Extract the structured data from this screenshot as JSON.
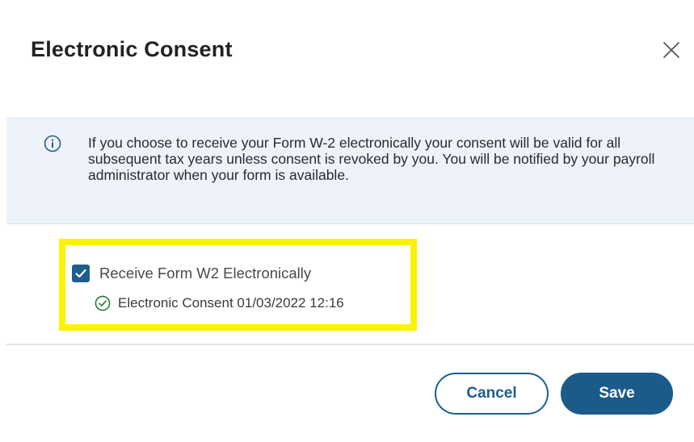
{
  "dialog": {
    "title": "Electronic Consent",
    "close_icon": "close-icon"
  },
  "info": {
    "icon": "info-circle-icon",
    "text": "If you choose to receive your Form W-2 electronically your consent will be valid for all subsequent tax years unless consent is revoked by you. You will be notified by your payroll administrator when your form is available."
  },
  "consent": {
    "checkbox_label": "Receive Form W2 Electronically",
    "checked": true,
    "status_icon": "check-circle-icon",
    "status_text": "Electronic Consent 01/03/2022 12:16"
  },
  "actions": {
    "cancel_label": "Cancel",
    "save_label": "Save"
  },
  "colors": {
    "primary": "#1a5b8a",
    "banner_background": "#eef3fb",
    "highlight": "#fbf200",
    "success": "#2e7d32"
  }
}
